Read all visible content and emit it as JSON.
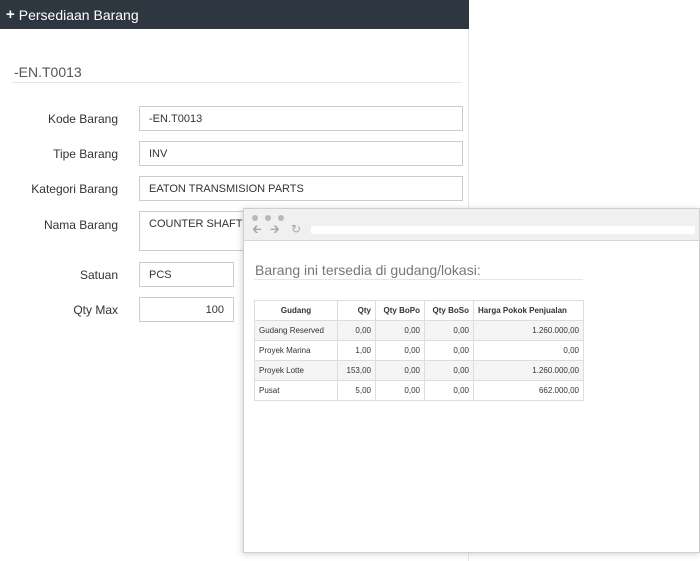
{
  "header": {
    "title": "Persediaan Barang"
  },
  "record": {
    "code_heading": "-EN.T0013"
  },
  "form": {
    "kode_barang": {
      "label": "Kode Barang",
      "value": "-EN.T0013"
    },
    "tipe_barang": {
      "label": "Tipe Barang",
      "value": "INV"
    },
    "kategori_barang": {
      "label": "Kategori Barang",
      "value": "EATON TRANSMISION PARTS"
    },
    "nama_barang": {
      "label": "Nama Barang",
      "value": "COUNTER SHAFT"
    },
    "satuan": {
      "label": "Satuan",
      "value": "PCS"
    },
    "qty_max": {
      "label": "Qty Max",
      "value": "100"
    }
  },
  "popup": {
    "title": "Barang ini tersedia di gudang/lokasi:",
    "columns": [
      "Gudang",
      "Qty",
      "Qty BoPo",
      "Qty BoSo",
      "Harga Pokok Penjualan"
    ],
    "rows": [
      {
        "gudang": "Gudang Reserved",
        "qty": "0,00",
        "qty_bopo": "0,00",
        "qty_boso": "0,00",
        "hpp": "1.260.000,00"
      },
      {
        "gudang": "Proyek Marina",
        "qty": "1,00",
        "qty_bopo": "0,00",
        "qty_boso": "0,00",
        "hpp": "0,00"
      },
      {
        "gudang": "Proyek Lotte",
        "qty": "153,00",
        "qty_bopo": "0,00",
        "qty_boso": "0,00",
        "hpp": "1.260.000,00"
      },
      {
        "gudang": "Pusat",
        "qty": "5,00",
        "qty_bopo": "0,00",
        "qty_boso": "0,00",
        "hpp": "662.000,00"
      }
    ]
  },
  "icons": {
    "header": "plus-icon",
    "nav_back": "arrow-left-icon",
    "nav_forward": "arrow-right-icon",
    "nav_reload": "reload-icon"
  },
  "colors": {
    "header_bg": "#2e3640",
    "border": "#cccccc"
  }
}
